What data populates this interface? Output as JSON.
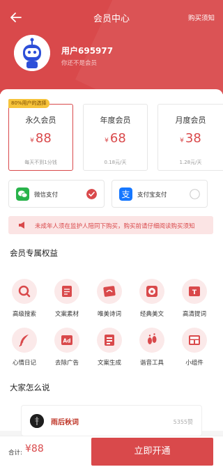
{
  "nav": {
    "title": "会员中心",
    "help_link": "购买须知",
    "back_icon": "back-arrow-icon"
  },
  "user": {
    "name": "用户695977",
    "status": "你还不是会员"
  },
  "plans": {
    "badge": "80%用户的选择",
    "items": [
      {
        "name": "永久会员",
        "currency": "¥",
        "price": "88",
        "note": "每天不到1分钱",
        "selected": true
      },
      {
        "name": "年度会员",
        "currency": "¥",
        "price": "68",
        "note": "0.18元/天",
        "selected": false
      },
      {
        "name": "月度会员",
        "currency": "¥",
        "price": "38",
        "note": "1.28元/天",
        "selected": false
      }
    ]
  },
  "payment": [
    {
      "label": "微信支付",
      "icon": "wechat-icon",
      "selected": true
    },
    {
      "label": "支付宝支付",
      "icon": "alipay-icon",
      "selected": false
    }
  ],
  "notice": {
    "text": "未成年人须在监护人陪同下购买，购买前请仔细阅读购买须知",
    "icon": "megaphone-icon"
  },
  "benefits": {
    "title": "会员专属权益",
    "items": [
      {
        "label": "高级搜索",
        "icon": "search-icon"
      },
      {
        "label": "文案素材",
        "icon": "document-icon"
      },
      {
        "label": "唯美诗词",
        "icon": "poem-icon"
      },
      {
        "label": "经典美文",
        "icon": "star-icon"
      },
      {
        "label": "高清提词",
        "icon": "teleprompter-icon"
      },
      {
        "label": "心情日记",
        "icon": "feather-icon"
      },
      {
        "label": "去除广告",
        "icon": "ad-icon"
      },
      {
        "label": "文案生成",
        "icon": "generate-icon"
      },
      {
        "label": "谐音工具",
        "icon": "footprint-icon"
      },
      {
        "label": "小组件",
        "icon": "widget-icon"
      }
    ]
  },
  "reviews": {
    "title": "大家怎么说",
    "items": [
      {
        "name": "雨后秋词",
        "likes": "5355赞"
      }
    ]
  },
  "checkout": {
    "total_label": "合计:",
    "total": "¥88",
    "buy_label": "立即开通"
  },
  "colors": {
    "primary": "#d9494b",
    "badge": "#f6c33a",
    "wechat": "#29b34b",
    "alipay": "#1677ff"
  }
}
